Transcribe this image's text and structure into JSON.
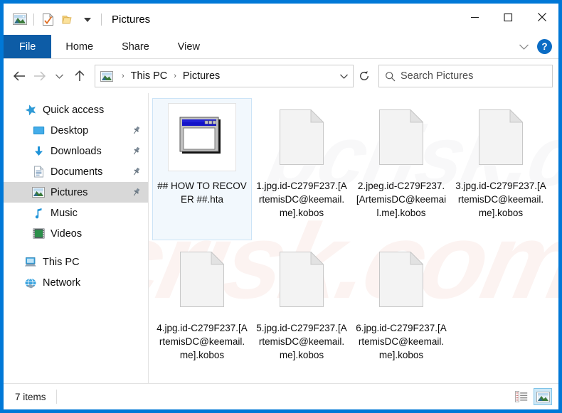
{
  "window": {
    "title": "Pictures",
    "quick_access_icons": [
      "pictures-folder-icon",
      "properties-icon",
      "new-folder-icon",
      "customize-dropdown-icon"
    ],
    "controls": {
      "minimize": "minimize-icon",
      "maximize": "maximize-icon",
      "close": "close-icon"
    }
  },
  "ribbon": {
    "tabs": [
      {
        "label": "File",
        "active": true
      },
      {
        "label": "Home",
        "active": false
      },
      {
        "label": "Share",
        "active": false
      },
      {
        "label": "View",
        "active": false
      }
    ],
    "expand_icon": "chevron-down-icon",
    "help_label": "?"
  },
  "navbar": {
    "back_icon": "back-arrow-icon",
    "forward_icon": "forward-arrow-icon",
    "recent_icon": "chevron-down-icon",
    "up_icon": "up-arrow-icon",
    "breadcrumb_icon": "pictures-folder-icon",
    "breadcrumbs": [
      "This PC",
      "Pictures"
    ],
    "separator": "›",
    "dropdown_icon": "chevron-down-icon",
    "refresh_icon": "refresh-icon",
    "search": {
      "icon": "search-icon",
      "placeholder": "Search Pictures",
      "value": ""
    }
  },
  "sidebar": {
    "items": [
      {
        "label": "Quick access",
        "icon": "star-icon",
        "level": "root",
        "pinned": false,
        "selected": false
      },
      {
        "label": "Desktop",
        "icon": "desktop-icon",
        "level": "indent",
        "pinned": true,
        "selected": false
      },
      {
        "label": "Downloads",
        "icon": "download-icon",
        "level": "indent",
        "pinned": true,
        "selected": false
      },
      {
        "label": "Documents",
        "icon": "documents-icon",
        "level": "indent",
        "pinned": true,
        "selected": false
      },
      {
        "label": "Pictures",
        "icon": "pictures-icon",
        "level": "indent",
        "pinned": true,
        "selected": true
      },
      {
        "label": "Music",
        "icon": "music-icon",
        "level": "indent",
        "pinned": false,
        "selected": false
      },
      {
        "label": "Videos",
        "icon": "videos-icon",
        "level": "indent",
        "pinned": false,
        "selected": false
      },
      {
        "label": "This PC",
        "icon": "computer-icon",
        "level": "root",
        "pinned": false,
        "selected": false
      },
      {
        "label": "Network",
        "icon": "network-icon",
        "level": "root",
        "pinned": false,
        "selected": false
      }
    ]
  },
  "content": {
    "watermark_text": "pcrisk.com",
    "files": [
      {
        "name": "## HOW TO RECOVER ##.hta",
        "icon": "hta-application-icon",
        "selected": true
      },
      {
        "name": "1.jpg.id-C279F237.[ArtemisDC@keemail.me].kobos",
        "icon": "generic-file-icon",
        "selected": false
      },
      {
        "name": "2.jpeg.id-C279F237.[ArtemisDC@keemail.me].kobos",
        "icon": "generic-file-icon",
        "selected": false
      },
      {
        "name": "3.jpg.id-C279F237.[ArtemisDC@keemail.me].kobos",
        "icon": "generic-file-icon",
        "selected": false
      },
      {
        "name": "4.jpg.id-C279F237.[ArtemisDC@keemail.me].kobos",
        "icon": "generic-file-icon",
        "selected": false
      },
      {
        "name": "5.jpg.id-C279F237.[ArtemisDC@keemail.me].kobos",
        "icon": "generic-file-icon",
        "selected": false
      },
      {
        "name": "6.jpg.id-C279F237.[ArtemisDC@keemail.me].kobos",
        "icon": "generic-file-icon",
        "selected": false
      }
    ]
  },
  "statusbar": {
    "item_count": "7 items",
    "views": [
      {
        "name": "details-view",
        "active": false
      },
      {
        "name": "large-icons-view",
        "active": true
      }
    ]
  },
  "colors": {
    "window_border": "#0078d7",
    "file_tab": "#0d5ca6",
    "selection": "#d8d8d8",
    "tile_selection": "#f2f8fd",
    "accent_blue": "#0b6cc4"
  }
}
